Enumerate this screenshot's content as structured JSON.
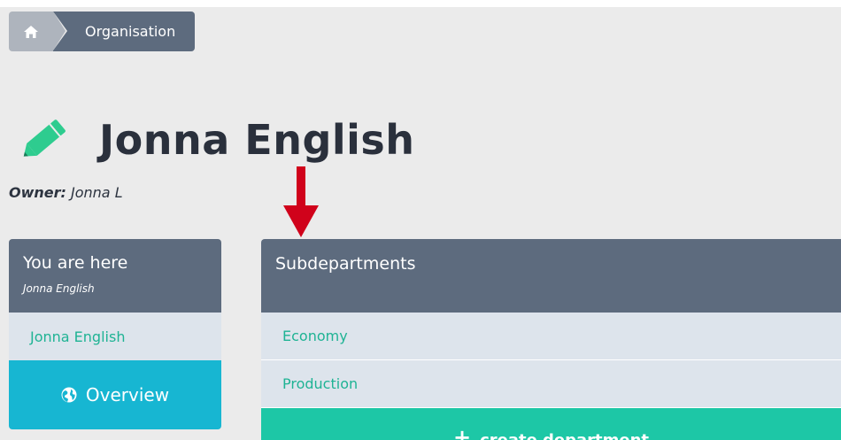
{
  "breadcrumb": {
    "home_icon": "home-icon",
    "items": [
      {
        "label": "Organisation"
      }
    ]
  },
  "page": {
    "title": "Jonna English",
    "title_icon": "pencil-icon",
    "owner_label": "Owner:",
    "owner_value": "Jonna L"
  },
  "sidebar": {
    "heading": "You are here",
    "subheading": "Jonna English",
    "current_link": "Jonna English",
    "overview_button": "Overview",
    "overview_icon": "globe-icon"
  },
  "subdepartments": {
    "heading": "Subdepartments",
    "items": [
      {
        "label": "Economy"
      },
      {
        "label": "Production"
      }
    ],
    "create_button": "create department"
  },
  "colors": {
    "header_slate": "#5d6b7e",
    "link_teal": "#1fb394",
    "overview_cyan": "#17b6d2",
    "create_green": "#1dc7a6",
    "annotation_arrow": "#d0021b"
  }
}
